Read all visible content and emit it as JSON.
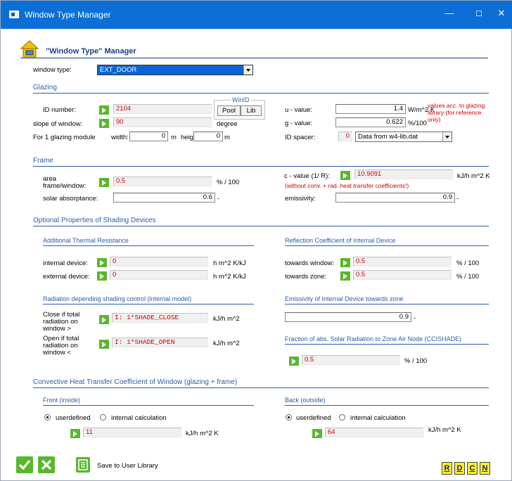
{
  "window": {
    "title": "Window Type Manager",
    "controls": {
      "minimize": "—",
      "maximize": "☐",
      "close": "✕"
    }
  },
  "header": {
    "title": "\"Window Type\" Manager"
  },
  "window_type": {
    "label": "window type:",
    "value": "EXT_DOOR"
  },
  "glazing": {
    "title": "Glazing",
    "id_number": {
      "label": "ID number:",
      "value": "2104"
    },
    "winid": {
      "title": "WinID",
      "pool": "Pool",
      "lib": "Lib"
    },
    "slope": {
      "label": "slope of window:",
      "value": "90",
      "unit": "degree"
    },
    "module": {
      "label": "For 1 glazing module",
      "width_label": "width:",
      "width_value": "0",
      "width_unit": "m",
      "height_label": "height:",
      "height_value": "0",
      "height_unit": "m"
    },
    "u_value": {
      "label": "u - value:",
      "value": "1.4",
      "unit": "W/m^2 K"
    },
    "g_value": {
      "label": "g - value:",
      "value": "0.622",
      "unit": "%/100"
    },
    "note": "values acc. to glazing library (for reference only)",
    "id_spacer": {
      "label": "ID spacer:",
      "value": "0",
      "option": "Data from w4-lib.dat"
    }
  },
  "frame": {
    "title": "Frame",
    "area": {
      "label": "area frame/window:",
      "value": "0.5",
      "unit": "% / 100"
    },
    "c_value": {
      "label": "c - value (1/ R):",
      "value": "10.9091",
      "unit": "kJ/h m^2 K",
      "note": "(without conv. + rad. heat transfer coefficients!)"
    },
    "solar": {
      "label": "solar absorptance:",
      "value": "0.6",
      "unit": "-"
    },
    "emissivity": {
      "label": "emissivity:",
      "value": "0.9",
      "unit": "-"
    }
  },
  "shading": {
    "title": "Optional Properties of Shading Devices",
    "thermal": {
      "title": "Additional Thermal Resistance",
      "internal": {
        "label": "internal device:",
        "value": "0",
        "unit": "h m^2 K/kJ"
      },
      "external": {
        "label": "external device:",
        "value": "0",
        "unit": "h m^2 K/kJ"
      }
    },
    "reflection": {
      "title": "Reflection Coefficient of Internal Device",
      "window": {
        "label": "towards window:",
        "value": "0.5",
        "unit": "% / 100"
      },
      "zone": {
        "label": "towards zone:",
        "value": "0.5",
        "unit": "% / 100"
      }
    },
    "radiation": {
      "title": "Radiation depending shading control (internal model)",
      "close": {
        "label": "Close if total radiation on window >",
        "value": "I: 1*SHADE_CLOSE",
        "unit": "kJ/h m^2"
      },
      "open": {
        "label": "Open if total radiation on window <",
        "value": "I: 1*SHADE_OPEN",
        "unit": "kJ/h m^2"
      }
    },
    "emissivity_int": {
      "title": "Emissivity of Internal Device towards zone",
      "value": "0.9",
      "unit": "-"
    },
    "fraction": {
      "title": "Fraction of abs. Solar Radiation to Zone Air Node (CCISHADE)",
      "value": "0.5",
      "unit": "% / 100"
    }
  },
  "convective": {
    "title": "Convective Heat Transfer Coefficient of Window (glazing + frame)",
    "front": {
      "title": "Front (inside)",
      "userdefined": "userdefined",
      "internal": "internal calculation",
      "value": "11",
      "unit": "kJ/h m^2 K"
    },
    "back": {
      "title": "Back (outside)",
      "userdefined": "userdefined",
      "internal": "internal calculation",
      "value": "64",
      "unit": "kJ/h m^2 K"
    }
  },
  "footer": {
    "save_label": "Save to User Library",
    "letters": [
      "R",
      "D",
      "C",
      "N"
    ]
  },
  "colors": {
    "titlebar": "#0b6fd6",
    "section": "#2a5ca8",
    "green": "#58b82c",
    "red": "#d40000",
    "select": "#0a64d6"
  }
}
